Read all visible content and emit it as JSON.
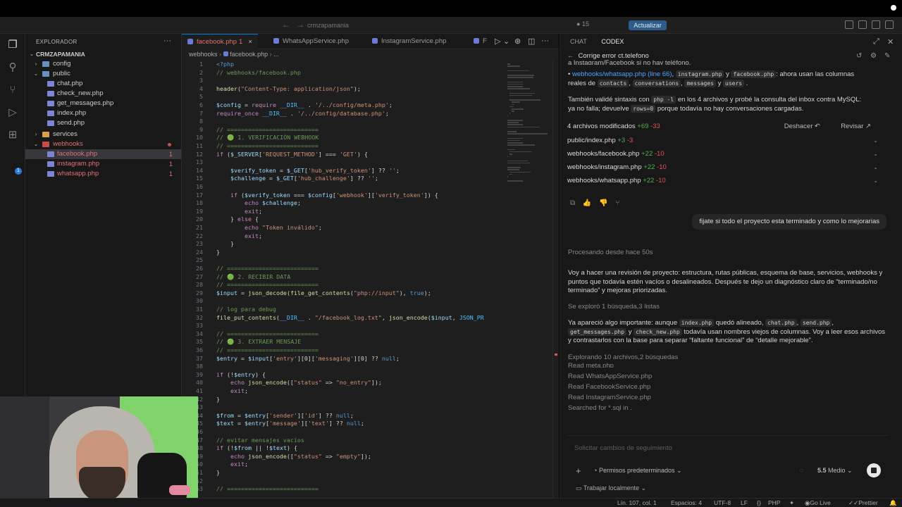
{
  "titlebar": {
    "search": "crmzapamania",
    "count": "15",
    "update_label": "Actualizar"
  },
  "explorer": {
    "header": "EXPLORADOR",
    "root": "CRMZAPAMANIA",
    "items": [
      {
        "label": "config",
        "type": "folder"
      },
      {
        "label": "public",
        "type": "folder"
      },
      {
        "label": "chat.php",
        "type": "file"
      },
      {
        "label": "check_new.php",
        "type": "file"
      },
      {
        "label": "get_messages.php",
        "type": "file"
      },
      {
        "label": "index.php",
        "type": "file"
      },
      {
        "label": "send.php",
        "type": "file"
      },
      {
        "label": "services",
        "type": "folder"
      },
      {
        "label": "webhooks",
        "type": "folder"
      },
      {
        "label": "facebook.php",
        "type": "file",
        "count": "1"
      },
      {
        "label": "instagram.php",
        "type": "file",
        "count": "1"
      },
      {
        "label": "whatsapp.php",
        "type": "file",
        "count": "1"
      }
    ]
  },
  "editor": {
    "tabs": [
      {
        "label": "facebook.php",
        "badge": "1"
      },
      {
        "label": "WhatsAppService.php"
      },
      {
        "label": "InstagramService.php"
      },
      {
        "label": "F"
      }
    ],
    "breadcrumb": [
      "webhooks",
      "facebook.php",
      "..."
    ],
    "code": [
      {
        "n": "1",
        "t": "<?php"
      },
      {
        "n": "2",
        "t": "// webhooks/facebook.php"
      },
      {
        "n": "3",
        "t": ""
      },
      {
        "n": "4",
        "t": "header(\"Content-Type: application/json\");"
      },
      {
        "n": "5",
        "t": ""
      },
      {
        "n": "6",
        "t": "$config = require __DIR__ . '/../config/meta.php';"
      },
      {
        "n": "7",
        "t": "require_once __DIR__ . '/../config/database.php';"
      },
      {
        "n": "8",
        "t": ""
      },
      {
        "n": "9",
        "t": "// =========================="
      },
      {
        "n": "10",
        "t": "// 🟢 1. VERIFICACIÓN WEBHOOK"
      },
      {
        "n": "11",
        "t": "// =========================="
      },
      {
        "n": "12",
        "t": "if ($_SERVER['REQUEST_METHOD'] === 'GET') {"
      },
      {
        "n": "13",
        "t": ""
      },
      {
        "n": "14",
        "t": "    $verify_token = $_GET['hub_verify_token'] ?? '';"
      },
      {
        "n": "15",
        "t": "    $challenge = $_GET['hub_challenge'] ?? '';"
      },
      {
        "n": "16",
        "t": ""
      },
      {
        "n": "17",
        "t": "    if ($verify_token === $config['webhook']['verify_token']) {"
      },
      {
        "n": "18",
        "t": "        echo $challenge;"
      },
      {
        "n": "19",
        "t": "        exit;"
      },
      {
        "n": "20",
        "t": "    } else {"
      },
      {
        "n": "21",
        "t": "        echo \"Token inválido\";"
      },
      {
        "n": "22",
        "t": "        exit;"
      },
      {
        "n": "23",
        "t": "    }"
      },
      {
        "n": "24",
        "t": "}"
      },
      {
        "n": "25",
        "t": ""
      },
      {
        "n": "26",
        "t": "// =========================="
      },
      {
        "n": "27",
        "t": "// 🟢 2. RECIBIR DATA"
      },
      {
        "n": "28",
        "t": "// =========================="
      },
      {
        "n": "29",
        "t": "$input = json_decode(file_get_contents(\"php://input\"), true);"
      },
      {
        "n": "30",
        "t": ""
      },
      {
        "n": "31",
        "t": "// log para debug"
      },
      {
        "n": "32",
        "t": "file_put_contents(__DIR__ . \"/facebook_log.txt\", json_encode($input, JSON_PR"
      },
      {
        "n": "33",
        "t": ""
      },
      {
        "n": "34",
        "t": "// =========================="
      },
      {
        "n": "35",
        "t": "// 🟢 3. EXTRAER MENSAJE"
      },
      {
        "n": "36",
        "t": "// =========================="
      },
      {
        "n": "37",
        "t": "$entry = $input['entry'][0]['messaging'][0] ?? null;"
      },
      {
        "n": "38",
        "t": ""
      },
      {
        "n": "39",
        "t": "if (!$entry) {"
      },
      {
        "n": "40",
        "t": "    echo json_encode([\"status\" => \"no_entry\"]);"
      },
      {
        "n": "41",
        "t": "    exit;"
      },
      {
        "n": "42",
        "t": "}"
      },
      {
        "n": "43",
        "t": ""
      },
      {
        "n": "44",
        "t": "$from = $entry['sender']['id'] ?? null;"
      },
      {
        "n": "45",
        "t": "$text = $entry['message']['text'] ?? null;"
      },
      {
        "n": "46",
        "t": ""
      },
      {
        "n": "47",
        "t": "// evitar mensajes vacíos"
      },
      {
        "n": "48",
        "t": "if (!$from || !$text) {"
      },
      {
        "n": "49",
        "t": "    echo json_encode([\"status\" => \"empty\"]);"
      },
      {
        "n": "50",
        "t": "    exit;"
      },
      {
        "n": "51",
        "t": "}"
      },
      {
        "n": "52",
        "t": ""
      },
      {
        "n": "53",
        "t": "// =========================="
      }
    ]
  },
  "chat": {
    "tabs": [
      "CHAT",
      "CODEX"
    ],
    "thread_title": "Corrige error ct.telefono",
    "frag_top": "a Instagram/Facebook si no hay teléfono.",
    "bullet_link": "webhooks/whatsapp.php (line 66)",
    "bullet_chips": [
      "instagram.php",
      "facebook.php",
      "contacts",
      "conversations",
      "messages",
      "users"
    ],
    "bullet_text_a": ",",
    "bullet_text_b": "y",
    "bullet_text_c": ": ahora usan las columnas",
    "bullet_text_d": "reales de",
    "bullet_text_e": ",",
    "bullet_text_f": ",",
    "bullet_text_g": "y",
    "validated_a": "También validé sintaxis con",
    "validated_chip": "php -l",
    "validated_b": "en los 4 archivos y probé la consulta del inbox contra MySQL:",
    "validated_c": "ya no falla; devuelve",
    "validated_chip2": "rows=0",
    "validated_d": "porque todavía no hay conversaciones cargadas.",
    "changes_header": "4 archivos modificados",
    "changes_plus": "+69",
    "changes_minus": "-33",
    "undo": "Deshacer",
    "review": "Revisar",
    "changed_files": [
      {
        "name": "public/index.php",
        "plus": "+3",
        "minus": "-3"
      },
      {
        "name": "webhooks/facebook.php",
        "plus": "+22",
        "minus": "-10"
      },
      {
        "name": "webhooks/instagram.php",
        "plus": "+22",
        "minus": "-10"
      },
      {
        "name": "webhooks/whatsapp.php",
        "plus": "+22",
        "minus": "-10"
      }
    ],
    "user_message": "fijate si todo el proyecto esta terminado y como lo mejorarias",
    "processing": "Procesando desde hace 50s",
    "para1": "Voy a hacer una revisión de proyecto: estructura, rutas públicas, esquema de base, servicios, webhooks y puntos que todavía estén vacíos o desalineados. Después te dejo un diagnóstico claro de “terminado/no terminado” y mejoras priorizadas.",
    "explored": "Se exploró 1 búsqueda,3 listas",
    "para2_a": "Ya apareció algo importante: aunque",
    "para2_chip1": "index.php",
    "para2_b": "quedó alineado,",
    "para2_chip2": "chat.php",
    "para2_c": ",",
    "para2_chip3": "send.php",
    "para2_d": ",",
    "para2_chip4": "get_messages.php",
    "para2_e": "y",
    "para2_chip5": "check_new.php",
    "para2_f": "todavía usan nombres viejos de columnas. Voy a leer esos archivos y contrastarlos con la base para separar “faltante funcional” de “detalle mejorable”.",
    "exploring": "Explorando 10 archivos,2 búsquedas",
    "reads": [
      "Read meta.php",
      "Read WhatsAppService.php",
      "Read FacebookService.php",
      "Read InstagramService.php",
      "Searched for *.sql in ."
    ],
    "composer_placeholder": "Solicitar cambios de seguimiento",
    "permissions": "Permisos predeterminados",
    "model": "5.5",
    "effort": "Medio",
    "local": "Trabajar localmente"
  },
  "statusbar": {
    "position": "Lín. 107, col. 1",
    "spaces": "Espacios: 4",
    "encoding": "UTF-8",
    "eol": "LF",
    "lang": "PHP",
    "golive": "Go Live",
    "prettier": "Prettier"
  }
}
